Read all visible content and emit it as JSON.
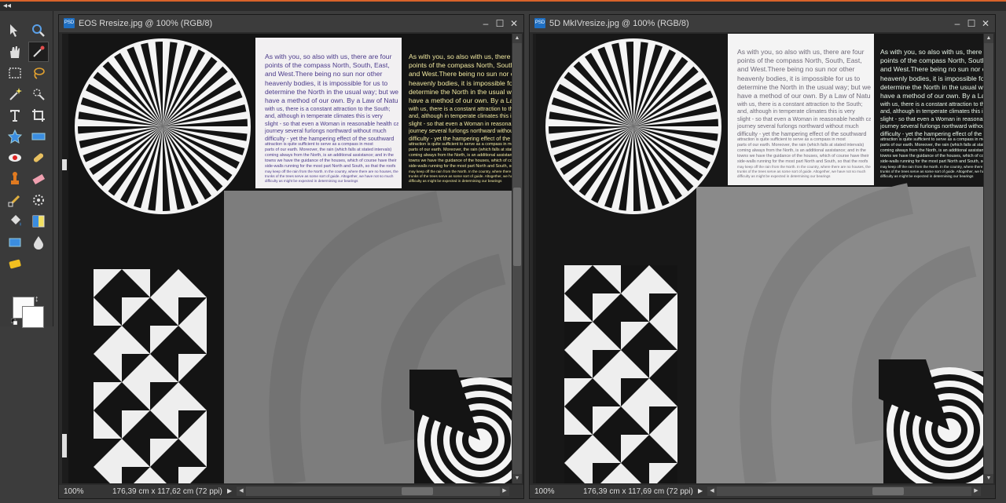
{
  "app": {
    "accent_color": "#d9632a",
    "collapse_glyph": "◂◂"
  },
  "toolbox": {
    "tools": [
      {
        "icon": "move-tool-icon"
      },
      {
        "icon": "zoom-tool-icon"
      },
      {
        "icon": "hand-tool-icon"
      },
      {
        "icon": "eyedropper-tool-icon",
        "active": true
      },
      {
        "icon": "rectangular-marquee-icon"
      },
      {
        "icon": "lasso-tool-icon"
      },
      {
        "icon": "magic-wand-icon"
      },
      {
        "icon": "quick-selection-icon"
      },
      {
        "icon": "type-tool-icon"
      },
      {
        "icon": "crop-tool-icon"
      },
      {
        "icon": "cookie-cutter-icon"
      },
      {
        "icon": "straighten-tool-icon"
      },
      {
        "icon": "red-eye-icon"
      },
      {
        "icon": "spot-healing-icon"
      },
      {
        "icon": "clone-stamp-icon"
      },
      {
        "icon": "eraser-icon"
      },
      {
        "icon": "brush-tool-icon"
      },
      {
        "icon": "smart-brush-icon"
      },
      {
        "icon": "paint-bucket-icon"
      },
      {
        "icon": "gradient-tool-icon"
      },
      {
        "icon": "shape-tool-icon"
      },
      {
        "icon": "blur-tool-icon"
      },
      {
        "icon": "sponge-tool-icon"
      }
    ],
    "foreground_color": "#fafafa",
    "background_color": "#ffffff"
  },
  "windows": [
    {
      "title": "EOS Rresize.jpg @ 100% (RGB/8)",
      "zoom": "100%",
      "dimensions": "176,39 cm x 117,62 cm (72 ppi)",
      "controls": {
        "minimize": "–",
        "maximize": "☐",
        "close": "✕"
      }
    },
    {
      "title": "5D MkIVresize.jpg @ 100% (RGB/8)",
      "zoom": "100%",
      "dimensions": "176,39 cm x 117,69 cm (72 ppi)",
      "controls": {
        "minimize": "–",
        "maximize": "☐",
        "close": "✕"
      }
    }
  ],
  "test_chart": {
    "text_lines": [
      "As with you, so also with us, there are four",
      "points of the compass North, South, East,",
      "and West.There being no sun nor other",
      "heavenly bodies, it is impossible for us to",
      "determine the North in the usual way; but we",
      "have a method of our own. By a Law of Nature",
      "with us, there is a constant attraction to the South;",
      "and, although in temperate climates this is very",
      "slight - so that even a Woman in reasonable health can",
      "journey several furlongs northward without much",
      "difficulty - yet the hampering effect of the southward",
      "attraction is quite sufficient to serve as a compass in most",
      "parts of our earth. Moreover, the rain (which falls at stated intervals)",
      "coming always from the North, is an additional assistance; and in the",
      "towns we have the guidance of the houses, which of course have their",
      "side-walls running for the most part North and South, so that the roofs",
      "may keep off the rain from the North. In the country, where there are no houses, the",
      "trunks of the trees serve as some sort of guide. Altogether, we have not so much",
      "difficulty as might be expected in determining our bearings"
    ],
    "colors": {
      "chart_black": "#141414",
      "chart_gray": "#7d7d7d",
      "chart_white": "#f4f4f4"
    }
  }
}
